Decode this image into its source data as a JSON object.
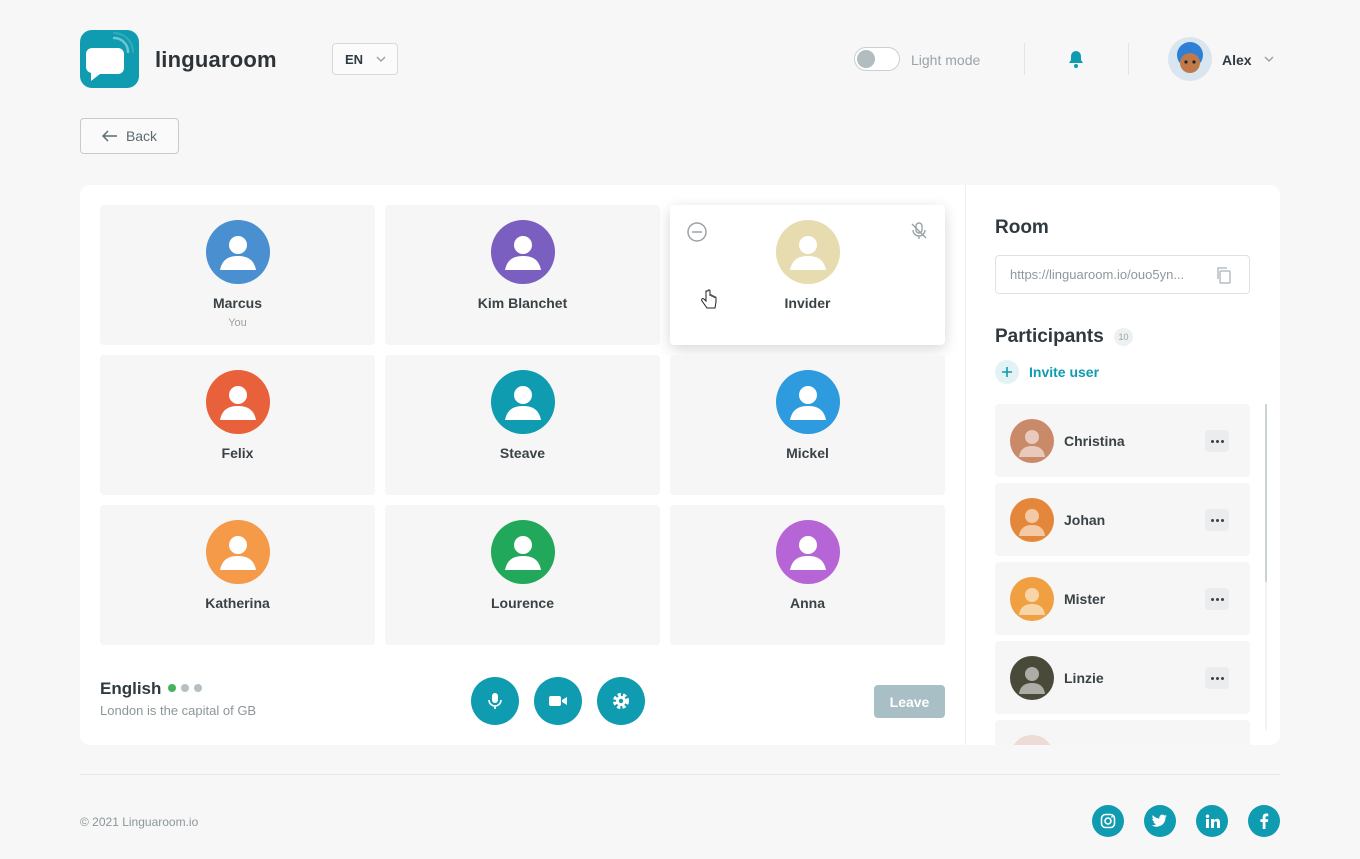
{
  "header": {
    "brand": "linguaroom",
    "language": "EN",
    "mode_label": "Light mode",
    "user_name": "Alex"
  },
  "back_label": "Back",
  "participant_tiles": [
    {
      "name": "Marcus",
      "sub": "You",
      "color": "#4a8fd0"
    },
    {
      "name": "Kim Blanchet",
      "sub": "",
      "color": "#7a5ec0"
    },
    {
      "name": "Invider",
      "sub": "",
      "color": "#e6dcb0"
    },
    {
      "name": "Felix",
      "sub": "",
      "color": "#e8613a"
    },
    {
      "name": "Steave",
      "sub": "",
      "color": "#0f9bb0"
    },
    {
      "name": "Mickel",
      "sub": "",
      "color": "#2e9bde"
    },
    {
      "name": "Katherina",
      "sub": "",
      "color": "#f49a48"
    },
    {
      "name": "Lourence",
      "sub": "",
      "color": "#22a85a"
    },
    {
      "name": "Anna",
      "sub": "",
      "color": "#b565d6"
    }
  ],
  "session": {
    "language": "English",
    "sentence": "London is the capital of GB",
    "dot_colors": [
      "#44b35a",
      "#b5c0c4",
      "#b5c0c4"
    ],
    "leave_label": "Leave"
  },
  "sidebar": {
    "room_title": "Room",
    "room_link": "https://linguaroom.io/ouo5yn...",
    "participants_title": "Participants",
    "participants_count": "10",
    "invite_label": "Invite user",
    "participants": [
      {
        "name": "Christina",
        "color": "#c98a6a"
      },
      {
        "name": "Johan",
        "color": "#e4873a"
      },
      {
        "name": "Mister",
        "color": "#f0a040"
      },
      {
        "name": "Linzie",
        "color": "#4a4a3a"
      }
    ]
  },
  "footer": {
    "copyright": "© 2021 Linguaroom.io",
    "social": [
      "instagram",
      "twitter",
      "linkedin",
      "facebook"
    ]
  },
  "colors": {
    "accent": "#0f9bb0"
  }
}
